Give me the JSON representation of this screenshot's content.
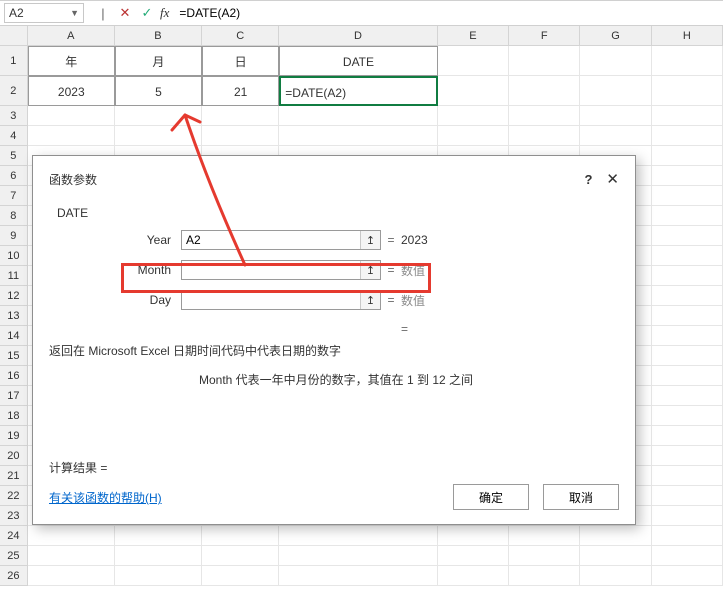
{
  "formula_bar": {
    "name_box": "A2",
    "formula": "=DATE(A2)"
  },
  "columns": [
    "A",
    "B",
    "C",
    "D",
    "E",
    "F",
    "G",
    "H"
  ],
  "rows": {
    "header": {
      "A": "年",
      "B": "月",
      "C": "日",
      "D": "DATE"
    },
    "data": {
      "A": "2023",
      "B": "5",
      "C": "21",
      "D": "=DATE(A2)"
    }
  },
  "row_numbers": [
    "1",
    "2",
    "3",
    "4",
    "5",
    "6",
    "7",
    "8",
    "9",
    "10",
    "11",
    "12",
    "13",
    "14",
    "15",
    "16",
    "17",
    "18",
    "19",
    "20",
    "21",
    "22",
    "23",
    "24",
    "25",
    "26"
  ],
  "dialog": {
    "title": "函数参数",
    "func_name": "DATE",
    "args": {
      "year": {
        "label": "Year",
        "value": "A2",
        "result": "2023"
      },
      "month": {
        "label": "Month",
        "value": "",
        "result": "数值"
      },
      "day": {
        "label": "Day",
        "value": "",
        "result": "数值"
      }
    },
    "overall_eq": "=",
    "desc1": "返回在 Microsoft Excel 日期时间代码中代表日期的数字",
    "desc2": "Month  代表一年中月份的数字，其值在 1 到 12 之间",
    "calc_result_label": "计算结果 =",
    "help_link": "有关该函数的帮助(H)",
    "ok": "确定",
    "cancel": "取消"
  }
}
